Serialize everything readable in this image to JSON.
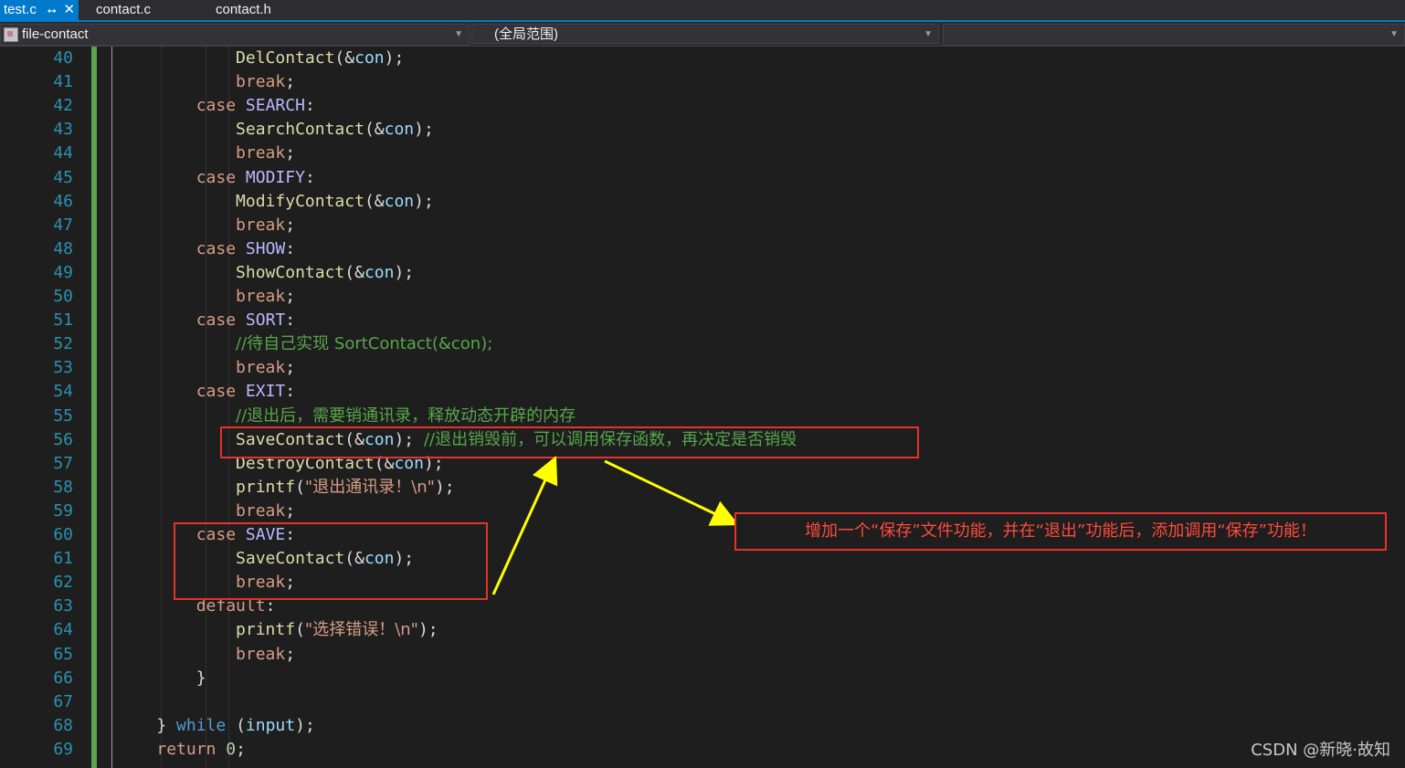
{
  "tabs": [
    {
      "label": "test.c",
      "active": true,
      "pin": "⭤",
      "close": "✕"
    },
    {
      "label": "contact.c"
    },
    {
      "label": "contact.h"
    }
  ],
  "navbar": {
    "project": "file-contact",
    "scope": "(全局范围)",
    "member": ""
  },
  "lines": [
    {
      "n": "40",
      "tokens": [
        {
          "t": "            ",
          "c": ""
        },
        {
          "t": "DelContact",
          "c": "fn"
        },
        {
          "t": "(&",
          "c": "punct"
        },
        {
          "t": "con",
          "c": "var"
        },
        {
          "t": ");",
          "c": "punct"
        }
      ]
    },
    {
      "n": "41",
      "tokens": [
        {
          "t": "            ",
          "c": ""
        },
        {
          "t": "break",
          "c": "kw"
        },
        {
          "t": ";",
          "c": "punct"
        }
      ]
    },
    {
      "n": "42",
      "tokens": [
        {
          "t": "        ",
          "c": ""
        },
        {
          "t": "case",
          "c": "kw"
        },
        {
          "t": " ",
          "c": ""
        },
        {
          "t": "SEARCH",
          "c": "macro"
        },
        {
          "t": ":",
          "c": "punct"
        }
      ]
    },
    {
      "n": "43",
      "tokens": [
        {
          "t": "            ",
          "c": ""
        },
        {
          "t": "SearchContact",
          "c": "fn"
        },
        {
          "t": "(&",
          "c": "punct"
        },
        {
          "t": "con",
          "c": "var"
        },
        {
          "t": ");",
          "c": "punct"
        }
      ]
    },
    {
      "n": "44",
      "tokens": [
        {
          "t": "            ",
          "c": ""
        },
        {
          "t": "break",
          "c": "kw"
        },
        {
          "t": ";",
          "c": "punct"
        }
      ]
    },
    {
      "n": "45",
      "tokens": [
        {
          "t": "        ",
          "c": ""
        },
        {
          "t": "case",
          "c": "kw"
        },
        {
          "t": " ",
          "c": ""
        },
        {
          "t": "MODIFY",
          "c": "macro"
        },
        {
          "t": ":",
          "c": "punct"
        }
      ]
    },
    {
      "n": "46",
      "tokens": [
        {
          "t": "            ",
          "c": ""
        },
        {
          "t": "ModifyContact",
          "c": "fn"
        },
        {
          "t": "(&",
          "c": "punct"
        },
        {
          "t": "con",
          "c": "var"
        },
        {
          "t": ");",
          "c": "punct"
        }
      ]
    },
    {
      "n": "47",
      "tokens": [
        {
          "t": "            ",
          "c": ""
        },
        {
          "t": "break",
          "c": "kw"
        },
        {
          "t": ";",
          "c": "punct"
        }
      ]
    },
    {
      "n": "48",
      "tokens": [
        {
          "t": "        ",
          "c": ""
        },
        {
          "t": "case",
          "c": "kw"
        },
        {
          "t": " ",
          "c": ""
        },
        {
          "t": "SHOW",
          "c": "macro"
        },
        {
          "t": ":",
          "c": "punct"
        }
      ]
    },
    {
      "n": "49",
      "tokens": [
        {
          "t": "            ",
          "c": ""
        },
        {
          "t": "ShowContact",
          "c": "fn"
        },
        {
          "t": "(&",
          "c": "punct"
        },
        {
          "t": "con",
          "c": "var"
        },
        {
          "t": ");",
          "c": "punct"
        }
      ]
    },
    {
      "n": "50",
      "tokens": [
        {
          "t": "            ",
          "c": ""
        },
        {
          "t": "break",
          "c": "kw"
        },
        {
          "t": ";",
          "c": "punct"
        }
      ]
    },
    {
      "n": "51",
      "tokens": [
        {
          "t": "        ",
          "c": ""
        },
        {
          "t": "case",
          "c": "kw"
        },
        {
          "t": " ",
          "c": ""
        },
        {
          "t": "SORT",
          "c": "macro"
        },
        {
          "t": ":",
          "c": "punct"
        }
      ]
    },
    {
      "n": "52",
      "tokens": [
        {
          "t": "            ",
          "c": ""
        },
        {
          "t": "//待自己实现 SortContact(&con);",
          "c": "cmt"
        }
      ]
    },
    {
      "n": "53",
      "tokens": [
        {
          "t": "            ",
          "c": ""
        },
        {
          "t": "break",
          "c": "kw"
        },
        {
          "t": ";",
          "c": "punct"
        }
      ]
    },
    {
      "n": "54",
      "tokens": [
        {
          "t": "        ",
          "c": ""
        },
        {
          "t": "case",
          "c": "kw"
        },
        {
          "t": " ",
          "c": ""
        },
        {
          "t": "EXIT",
          "c": "macro"
        },
        {
          "t": ":",
          "c": "punct"
        }
      ]
    },
    {
      "n": "55",
      "tokens": [
        {
          "t": "            ",
          "c": ""
        },
        {
          "t": "//退出后，需要销通讯录，释放动态开辟的内存",
          "c": "cmt"
        }
      ]
    },
    {
      "n": "56",
      "tokens": [
        {
          "t": "            ",
          "c": ""
        },
        {
          "t": "SaveContact",
          "c": "fn"
        },
        {
          "t": "(&",
          "c": "punct"
        },
        {
          "t": "con",
          "c": "var"
        },
        {
          "t": "); ",
          "c": "punct"
        },
        {
          "t": "//退出销毁前，可以调用保存函数，再决定是否销毁",
          "c": "cmt"
        }
      ]
    },
    {
      "n": "57",
      "tokens": [
        {
          "t": "            ",
          "c": ""
        },
        {
          "t": "DestroyContact",
          "c": "fn"
        },
        {
          "t": "(&",
          "c": "punct"
        },
        {
          "t": "con",
          "c": "var"
        },
        {
          "t": ");",
          "c": "punct"
        }
      ]
    },
    {
      "n": "58",
      "tokens": [
        {
          "t": "            ",
          "c": ""
        },
        {
          "t": "printf",
          "c": "fn"
        },
        {
          "t": "(",
          "c": "punct"
        },
        {
          "t": "\"退出通讯录！\\n\"",
          "c": "str"
        },
        {
          "t": ");",
          "c": "punct"
        }
      ]
    },
    {
      "n": "59",
      "tokens": [
        {
          "t": "            ",
          "c": ""
        },
        {
          "t": "break",
          "c": "kw"
        },
        {
          "t": ";",
          "c": "punct"
        }
      ]
    },
    {
      "n": "60",
      "tokens": [
        {
          "t": "        ",
          "c": ""
        },
        {
          "t": "case",
          "c": "kw"
        },
        {
          "t": " ",
          "c": ""
        },
        {
          "t": "SAVE",
          "c": "macro"
        },
        {
          "t": ":",
          "c": "punct"
        }
      ]
    },
    {
      "n": "61",
      "tokens": [
        {
          "t": "            ",
          "c": ""
        },
        {
          "t": "SaveContact",
          "c": "fn"
        },
        {
          "t": "(&",
          "c": "punct"
        },
        {
          "t": "con",
          "c": "var"
        },
        {
          "t": ");",
          "c": "punct"
        }
      ]
    },
    {
      "n": "62",
      "tokens": [
        {
          "t": "            ",
          "c": ""
        },
        {
          "t": "break",
          "c": "kw"
        },
        {
          "t": ";",
          "c": "punct"
        }
      ]
    },
    {
      "n": "63",
      "tokens": [
        {
          "t": "        ",
          "c": ""
        },
        {
          "t": "default",
          "c": "kw"
        },
        {
          "t": ":",
          "c": "punct"
        }
      ]
    },
    {
      "n": "64",
      "tokens": [
        {
          "t": "            ",
          "c": ""
        },
        {
          "t": "printf",
          "c": "fn"
        },
        {
          "t": "(",
          "c": "punct"
        },
        {
          "t": "\"选择错误！\\n\"",
          "c": "str"
        },
        {
          "t": ");",
          "c": "punct"
        }
      ]
    },
    {
      "n": "65",
      "tokens": [
        {
          "t": "            ",
          "c": ""
        },
        {
          "t": "break",
          "c": "kw"
        },
        {
          "t": ";",
          "c": "punct"
        }
      ]
    },
    {
      "n": "66",
      "tokens": [
        {
          "t": "        ",
          "c": ""
        },
        {
          "t": "}",
          "c": "punct"
        }
      ]
    },
    {
      "n": "67",
      "tokens": []
    },
    {
      "n": "68",
      "tokens": [
        {
          "t": "    ",
          "c": ""
        },
        {
          "t": "} ",
          "c": "punct"
        },
        {
          "t": "while",
          "c": "kwb"
        },
        {
          "t": " (",
          "c": "punct"
        },
        {
          "t": "input",
          "c": "var"
        },
        {
          "t": ");",
          "c": "punct"
        }
      ]
    },
    {
      "n": "69",
      "tokens": [
        {
          "t": "    ",
          "c": ""
        },
        {
          "t": "return",
          "c": "kw"
        },
        {
          "t": " ",
          "c": ""
        },
        {
          "t": "0",
          "c": "num"
        },
        {
          "t": ";",
          "c": "punct"
        }
      ]
    }
  ],
  "annotation": {
    "note": "增加一个“保存”文件功能，并在“退出”功能后，添加调用“保存”功能！",
    "color": "#e5322d",
    "arrow_color": "#ffff00"
  },
  "watermark": "CSDN @新晓·故知",
  "colors": {
    "background": "#1e1e1e",
    "line_number": "#2b91af",
    "comment": "#57a64a",
    "function": "#dcdcaa",
    "keyword": "#d69d85",
    "accent": "#007acc"
  }
}
